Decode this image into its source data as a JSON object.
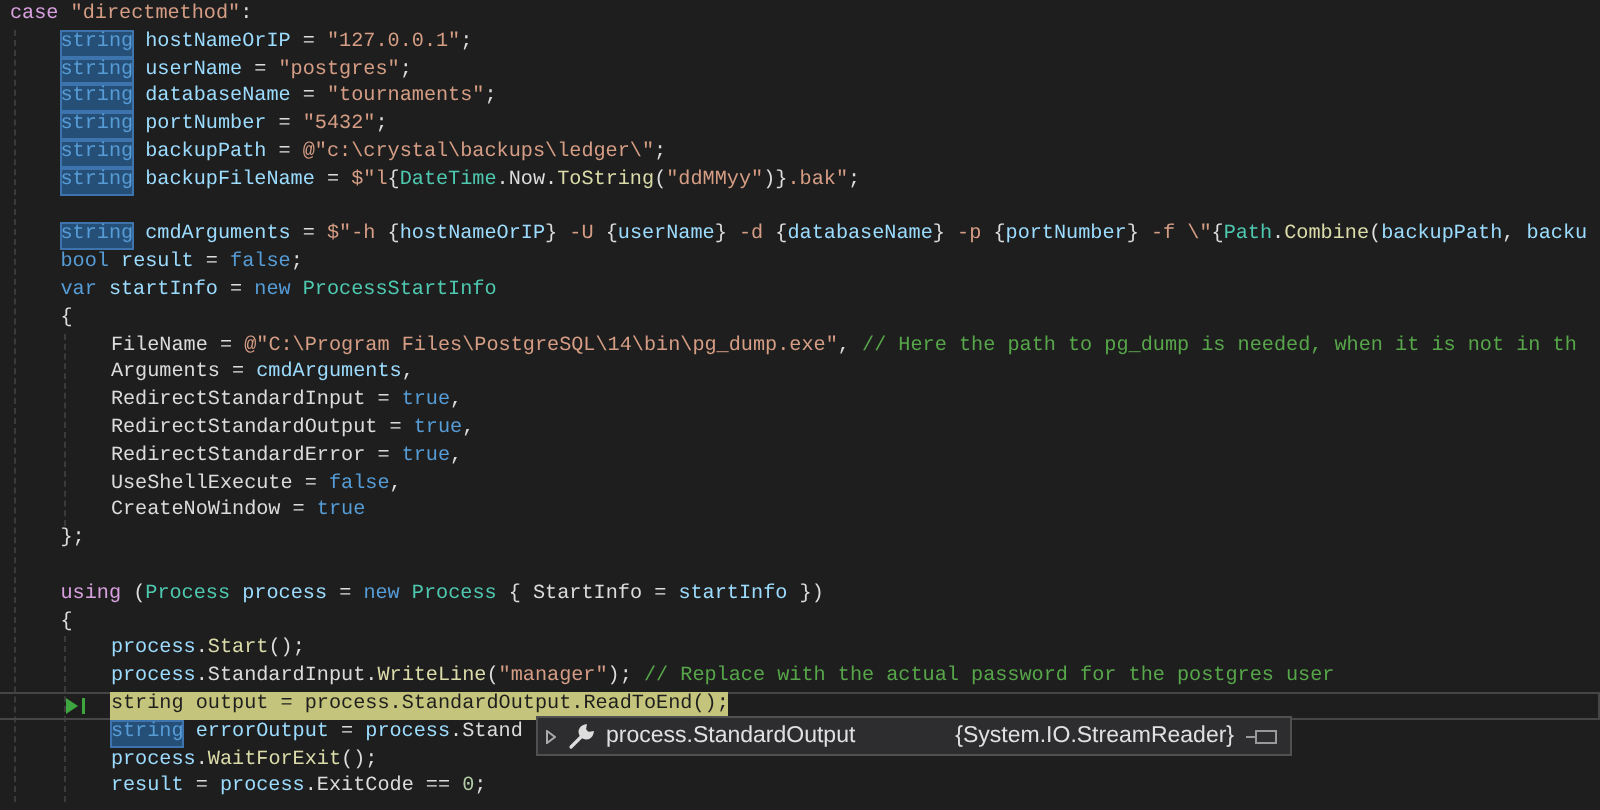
{
  "editor": {
    "lines": [
      {
        "kind": "code",
        "current": false,
        "tokens": [
          {
            "kind": "control",
            "text": "case"
          },
          {
            "kind": "string",
            "text": " \"directmethod\""
          },
          {
            "kind": "plain",
            "text": ":"
          }
        ],
        "children": [
          {
            "kind": "code",
            "current": false,
            "tokens": [
              {
                "kind": "reference",
                "text": "string"
              },
              {
                "kind": "local",
                "text": " hostNameOrIP"
              },
              {
                "kind": "plain",
                "text": " = "
              },
              {
                "kind": "string",
                "text": "\"127.0.0.1\""
              },
              {
                "kind": "plain",
                "text": ";"
              }
            ]
          },
          {
            "kind": "code",
            "current": false,
            "tokens": [
              {
                "kind": "reference",
                "text": "string"
              },
              {
                "kind": "local",
                "text": " userName"
              },
              {
                "kind": "plain",
                "text": " = "
              },
              {
                "kind": "string",
                "text": "\"postgres\""
              },
              {
                "kind": "plain",
                "text": ";"
              }
            ]
          },
          {
            "kind": "code",
            "current": false,
            "tokens": [
              {
                "kind": "reference",
                "text": "string"
              },
              {
                "kind": "local",
                "text": " databaseName"
              },
              {
                "kind": "plain",
                "text": " = "
              },
              {
                "kind": "string",
                "text": "\"tournaments\""
              },
              {
                "kind": "plain",
                "text": ";"
              }
            ]
          },
          {
            "kind": "code",
            "current": false,
            "tokens": [
              {
                "kind": "reference",
                "text": "string"
              },
              {
                "kind": "local",
                "text": " portNumber"
              },
              {
                "kind": "plain",
                "text": " = "
              },
              {
                "kind": "string",
                "text": "\"5432\""
              },
              {
                "kind": "plain",
                "text": ";"
              }
            ]
          },
          {
            "kind": "code",
            "current": false,
            "tokens": [
              {
                "kind": "reference",
                "text": "string"
              },
              {
                "kind": "local",
                "text": " backupPath"
              },
              {
                "kind": "plain",
                "text": " = "
              },
              {
                "kind": "string",
                "text": "@\"c:\\crystal\\backups\\ledger\\\""
              },
              {
                "kind": "plain",
                "text": ";"
              }
            ]
          },
          {
            "kind": "code",
            "current": false,
            "tokens": [
              {
                "kind": "reference",
                "text": "string"
              },
              {
                "kind": "local",
                "text": " backupFileName"
              },
              {
                "kind": "plain",
                "text": " = "
              },
              {
                "kind": "string",
                "text": "$\"l"
              },
              {
                "kind": "plain",
                "text": "{"
              },
              {
                "kind": "type",
                "text": "DateTime"
              },
              {
                "kind": "plain",
                "text": ".Now."
              },
              {
                "kind": "method",
                "text": "ToString"
              },
              {
                "kind": "plain",
                "text": "("
              },
              {
                "kind": "string",
                "text": "\"ddMMyy\""
              },
              {
                "kind": "plain",
                "text": ")}"
              },
              {
                "kind": "string",
                "text": ".bak\""
              },
              {
                "kind": "plain",
                "text": ";"
              }
            ]
          },
          {
            "kind": "blank",
            "current": false
          },
          {
            "kind": "code",
            "current": false,
            "tokens": [
              {
                "kind": "reference",
                "text": "string"
              },
              {
                "kind": "local",
                "text": " cmdArguments"
              },
              {
                "kind": "plain",
                "text": " = "
              },
              {
                "kind": "string",
                "text": "$\"-h "
              },
              {
                "kind": "plain",
                "text": "{"
              },
              {
                "kind": "local",
                "text": "hostNameOrIP"
              },
              {
                "kind": "plain",
                "text": "}"
              },
              {
                "kind": "string",
                "text": " -U "
              },
              {
                "kind": "plain",
                "text": "{"
              },
              {
                "kind": "local",
                "text": "userName"
              },
              {
                "kind": "plain",
                "text": "}"
              },
              {
                "kind": "string",
                "text": " -d "
              },
              {
                "kind": "plain",
                "text": "{"
              },
              {
                "kind": "local",
                "text": "databaseName"
              },
              {
                "kind": "plain",
                "text": "}"
              },
              {
                "kind": "string",
                "text": " -p "
              },
              {
                "kind": "plain",
                "text": "{"
              },
              {
                "kind": "local",
                "text": "portNumber"
              },
              {
                "kind": "plain",
                "text": "}"
              },
              {
                "kind": "string",
                "text": " -f \\\""
              },
              {
                "kind": "plain",
                "text": "{"
              },
              {
                "kind": "type",
                "text": "Path"
              },
              {
                "kind": "plain",
                "text": "."
              },
              {
                "kind": "method",
                "text": "Combine"
              },
              {
                "kind": "plain",
                "text": "("
              },
              {
                "kind": "local",
                "text": "backupPath"
              },
              {
                "kind": "plain",
                "text": ", "
              },
              {
                "kind": "local",
                "text": "backu"
              }
            ]
          },
          {
            "kind": "code",
            "current": false,
            "tokens": [
              {
                "kind": "keyword",
                "text": "bool"
              },
              {
                "kind": "local",
                "text": " result"
              },
              {
                "kind": "plain",
                "text": " = "
              },
              {
                "kind": "keyword",
                "text": "false"
              },
              {
                "kind": "plain",
                "text": ";"
              }
            ]
          },
          {
            "kind": "code",
            "current": false,
            "tokens": [
              {
                "kind": "keyword",
                "text": "var"
              },
              {
                "kind": "local",
                "text": " startInfo"
              },
              {
                "kind": "plain",
                "text": " = "
              },
              {
                "kind": "keyword",
                "text": "new"
              },
              {
                "kind": "type",
                "text": " ProcessStartInfo"
              }
            ]
          },
          {
            "kind": "code",
            "current": false,
            "tokens": [
              {
                "kind": "plain",
                "text": "{"
              }
            ],
            "children": [
              {
                "kind": "code",
                "current": false,
                "tokens": [
                  {
                    "kind": "plain",
                    "text": "FileName = "
                  },
                  {
                    "kind": "string",
                    "text": "@\"C:\\Program Files\\PostgreSQL\\14\\bin\\pg_dump.exe\""
                  },
                  {
                    "kind": "plain",
                    "text": ", "
                  },
                  {
                    "kind": "comment",
                    "text": "// Here the path to pg_dump is needed, when it is not in th"
                  }
                ]
              },
              {
                "kind": "code",
                "current": false,
                "tokens": [
                  {
                    "kind": "plain",
                    "text": "Arguments = "
                  },
                  {
                    "kind": "local",
                    "text": "cmdArguments"
                  },
                  {
                    "kind": "plain",
                    "text": ","
                  }
                ]
              },
              {
                "kind": "code",
                "current": false,
                "tokens": [
                  {
                    "kind": "plain",
                    "text": "RedirectStandardInput = "
                  },
                  {
                    "kind": "keyword",
                    "text": "true"
                  },
                  {
                    "kind": "plain",
                    "text": ","
                  }
                ]
              },
              {
                "kind": "code",
                "current": false,
                "tokens": [
                  {
                    "kind": "plain",
                    "text": "RedirectStandardOutput = "
                  },
                  {
                    "kind": "keyword",
                    "text": "true"
                  },
                  {
                    "kind": "plain",
                    "text": ","
                  }
                ]
              },
              {
                "kind": "code",
                "current": false,
                "tokens": [
                  {
                    "kind": "plain",
                    "text": "RedirectStandardError = "
                  },
                  {
                    "kind": "keyword",
                    "text": "true"
                  },
                  {
                    "kind": "plain",
                    "text": ","
                  }
                ]
              },
              {
                "kind": "code",
                "current": false,
                "tokens": [
                  {
                    "kind": "plain",
                    "text": "UseShellExecute = "
                  },
                  {
                    "kind": "keyword",
                    "text": "false"
                  },
                  {
                    "kind": "plain",
                    "text": ","
                  }
                ]
              },
              {
                "kind": "code",
                "current": false,
                "tokens": [
                  {
                    "kind": "plain",
                    "text": "CreateNoWindow = "
                  },
                  {
                    "kind": "keyword",
                    "text": "true"
                  }
                ]
              }
            ]
          },
          {
            "kind": "code",
            "current": false,
            "tokens": [
              {
                "kind": "plain",
                "text": "};"
              }
            ]
          },
          {
            "kind": "blank",
            "current": false
          },
          {
            "kind": "code",
            "current": false,
            "tokens": [
              {
                "kind": "control",
                "text": "using"
              },
              {
                "kind": "plain",
                "text": " ("
              },
              {
                "kind": "type",
                "text": "Process"
              },
              {
                "kind": "local",
                "text": " process"
              },
              {
                "kind": "plain",
                "text": " = "
              },
              {
                "kind": "keyword",
                "text": "new"
              },
              {
                "kind": "type",
                "text": " Process"
              },
              {
                "kind": "plain",
                "text": " { StartInfo = "
              },
              {
                "kind": "local",
                "text": "startInfo"
              },
              {
                "kind": "plain",
                "text": " })"
              }
            ]
          },
          {
            "kind": "code",
            "current": false,
            "tokens": [
              {
                "kind": "plain",
                "text": "{"
              }
            ],
            "children": [
              {
                "kind": "code",
                "current": false,
                "tokens": [
                  {
                    "kind": "local",
                    "text": "process"
                  },
                  {
                    "kind": "plain",
                    "text": "."
                  },
                  {
                    "kind": "method",
                    "text": "Start"
                  },
                  {
                    "kind": "plain",
                    "text": "();"
                  }
                ]
              },
              {
                "kind": "code",
                "current": false,
                "tokens": [
                  {
                    "kind": "local",
                    "text": "process"
                  },
                  {
                    "kind": "plain",
                    "text": ".StandardInput."
                  },
                  {
                    "kind": "method",
                    "text": "WriteLine"
                  },
                  {
                    "kind": "plain",
                    "text": "("
                  },
                  {
                    "kind": "string",
                    "text": "\"manager\""
                  },
                  {
                    "kind": "plain",
                    "text": "); "
                  },
                  {
                    "kind": "comment",
                    "text": "// Replace with the actual password for the postgres user"
                  }
                ]
              },
              {
                "kind": "code",
                "current": true,
                "tokens": [
                  {
                    "kind": "keyword",
                    "text": "string"
                  },
                  {
                    "kind": "local",
                    "text": " output"
                  },
                  {
                    "kind": "plain",
                    "text": " = "
                  },
                  {
                    "kind": "local",
                    "text": "process"
                  },
                  {
                    "kind": "plain",
                    "text": ".StandardOutput."
                  },
                  {
                    "kind": "method",
                    "text": "ReadToEnd"
                  },
                  {
                    "kind": "plain",
                    "text": "();"
                  }
                ]
              },
              {
                "kind": "code",
                "current": false,
                "tokens": [
                  {
                    "kind": "reference",
                    "text": "string"
                  },
                  {
                    "kind": "local",
                    "text": " errorOutput"
                  },
                  {
                    "kind": "plain",
                    "text": " = "
                  },
                  {
                    "kind": "local",
                    "text": "process"
                  },
                  {
                    "kind": "plain",
                    "text": ".Stand"
                  }
                ]
              },
              {
                "kind": "code",
                "current": false,
                "tokens": [
                  {
                    "kind": "local",
                    "text": "process"
                  },
                  {
                    "kind": "plain",
                    "text": "."
                  },
                  {
                    "kind": "method",
                    "text": "WaitForExit"
                  },
                  {
                    "kind": "plain",
                    "text": "();"
                  }
                ]
              },
              {
                "kind": "code",
                "current": false,
                "tokens": [
                  {
                    "kind": "local",
                    "text": "result"
                  },
                  {
                    "kind": "plain",
                    "text": " = "
                  },
                  {
                    "kind": "local",
                    "text": "process"
                  },
                  {
                    "kind": "plain",
                    "text": ".ExitCode == "
                  },
                  {
                    "kind": "number",
                    "text": "0"
                  },
                  {
                    "kind": "plain",
                    "text": ";"
                  }
                ]
              }
            ]
          }
        ]
      }
    ]
  },
  "datatip": {
    "expression": "process.StandardOutput",
    "value": "{System.IO.StreamReader}"
  }
}
